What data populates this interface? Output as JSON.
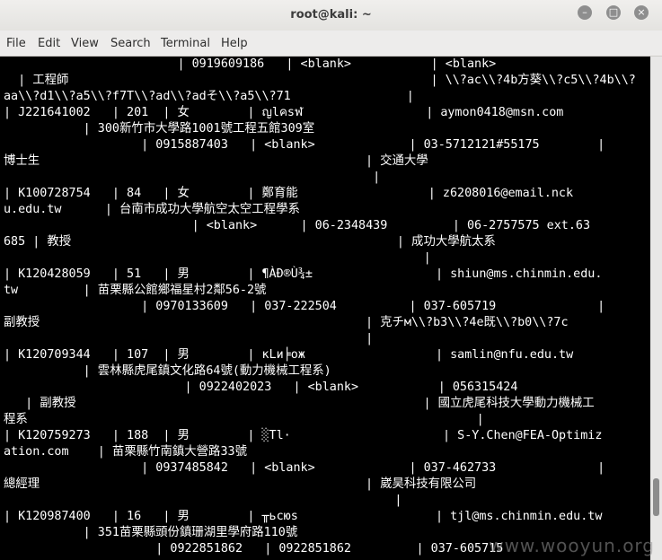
{
  "window": {
    "title": "root@kali: ~",
    "buttons": {
      "minimize": "–",
      "maximize": "□",
      "close": "×"
    }
  },
  "menu": [
    "File",
    "Edit",
    "View",
    "Search",
    "Terminal",
    "Help"
  ],
  "terminal_lines": [
    "                        | 0919609186   | <blank>           | <blank>",
    "  | 工程師                                                  | \\\\?ac\\\\?4b方葵\\\\?c5\\\\?4b\\\\?",
    "aa\\\\?d1\\\\?a5\\\\?f7T\\\\?ad\\\\?adそ\\\\?a5\\\\?71                |",
    "| J221641002   | 201  | 女        | ญlคsฬ                 | aymon0418@msn.com",
    "           | 300新竹市大學路1001號工程五館309室",
    "                   | 0915887403   | <blank>             | 03-5712121#55175        |",
    "博士生                                             | 交通大學",
    "                                                   |",
    "| K100728754   | 84   | 女        | 鄭育能                  | z6208016@email.nck",
    "u.edu.tw      | 台南市成功大學航空太空工程學系",
    "                          | <blank>      | 06-2348439         | 06-2757575 ext.63",
    "685 | 教授                                             | 成功大學航太系",
    "                                                          |",
    "| K120428059   | 51   | 男        | ¶ÀÐ®Ù¾±                 | shiun@ms.chinmin.edu.",
    "tw         | 苗栗縣公館鄉福星村2鄰56-2號",
    "                   | 0970133609   | 037-222504          | 037-605719              |",
    "副教授                                             | 克チм\\\\?b3\\\\?4e既\\\\?b0\\\\?7c",
    "                                                  |",
    "| K120709344   | 107  | 男        | κLи╞ож                  | samlin@nfu.edu.tw",
    "           | 雲林縣虎尾鎮文化路64號(動力機械工程系)",
    "                         | 0922402023   | <blank>           | 056315424",
    "   | 副教授                                                | 國立虎尾科技大學動力機械工",
    "程系                                                              |",
    "| K120759273   | 188  | 男        | ░Tl·                     | S-Y.Chen@FEA-Optimiz",
    "ation.com    | 苗栗縣竹南鎮大營路33號",
    "                   | 0937485842   | <blank>             | 037-462733              |",
    "總經理                                             | 崴昊科技有限公司",
    "                                                      |",
    "| K120987400   | 16   | 男        | ╥ьсюs                   | tjl@ms.chinmin.edu.tw",
    "           | 351苗栗縣頭份鎮珊湖里學府路110號",
    "                     | 0922851862   | 0922851862         | 037-605715"
  ],
  "watermark": "www.wooyun.org"
}
